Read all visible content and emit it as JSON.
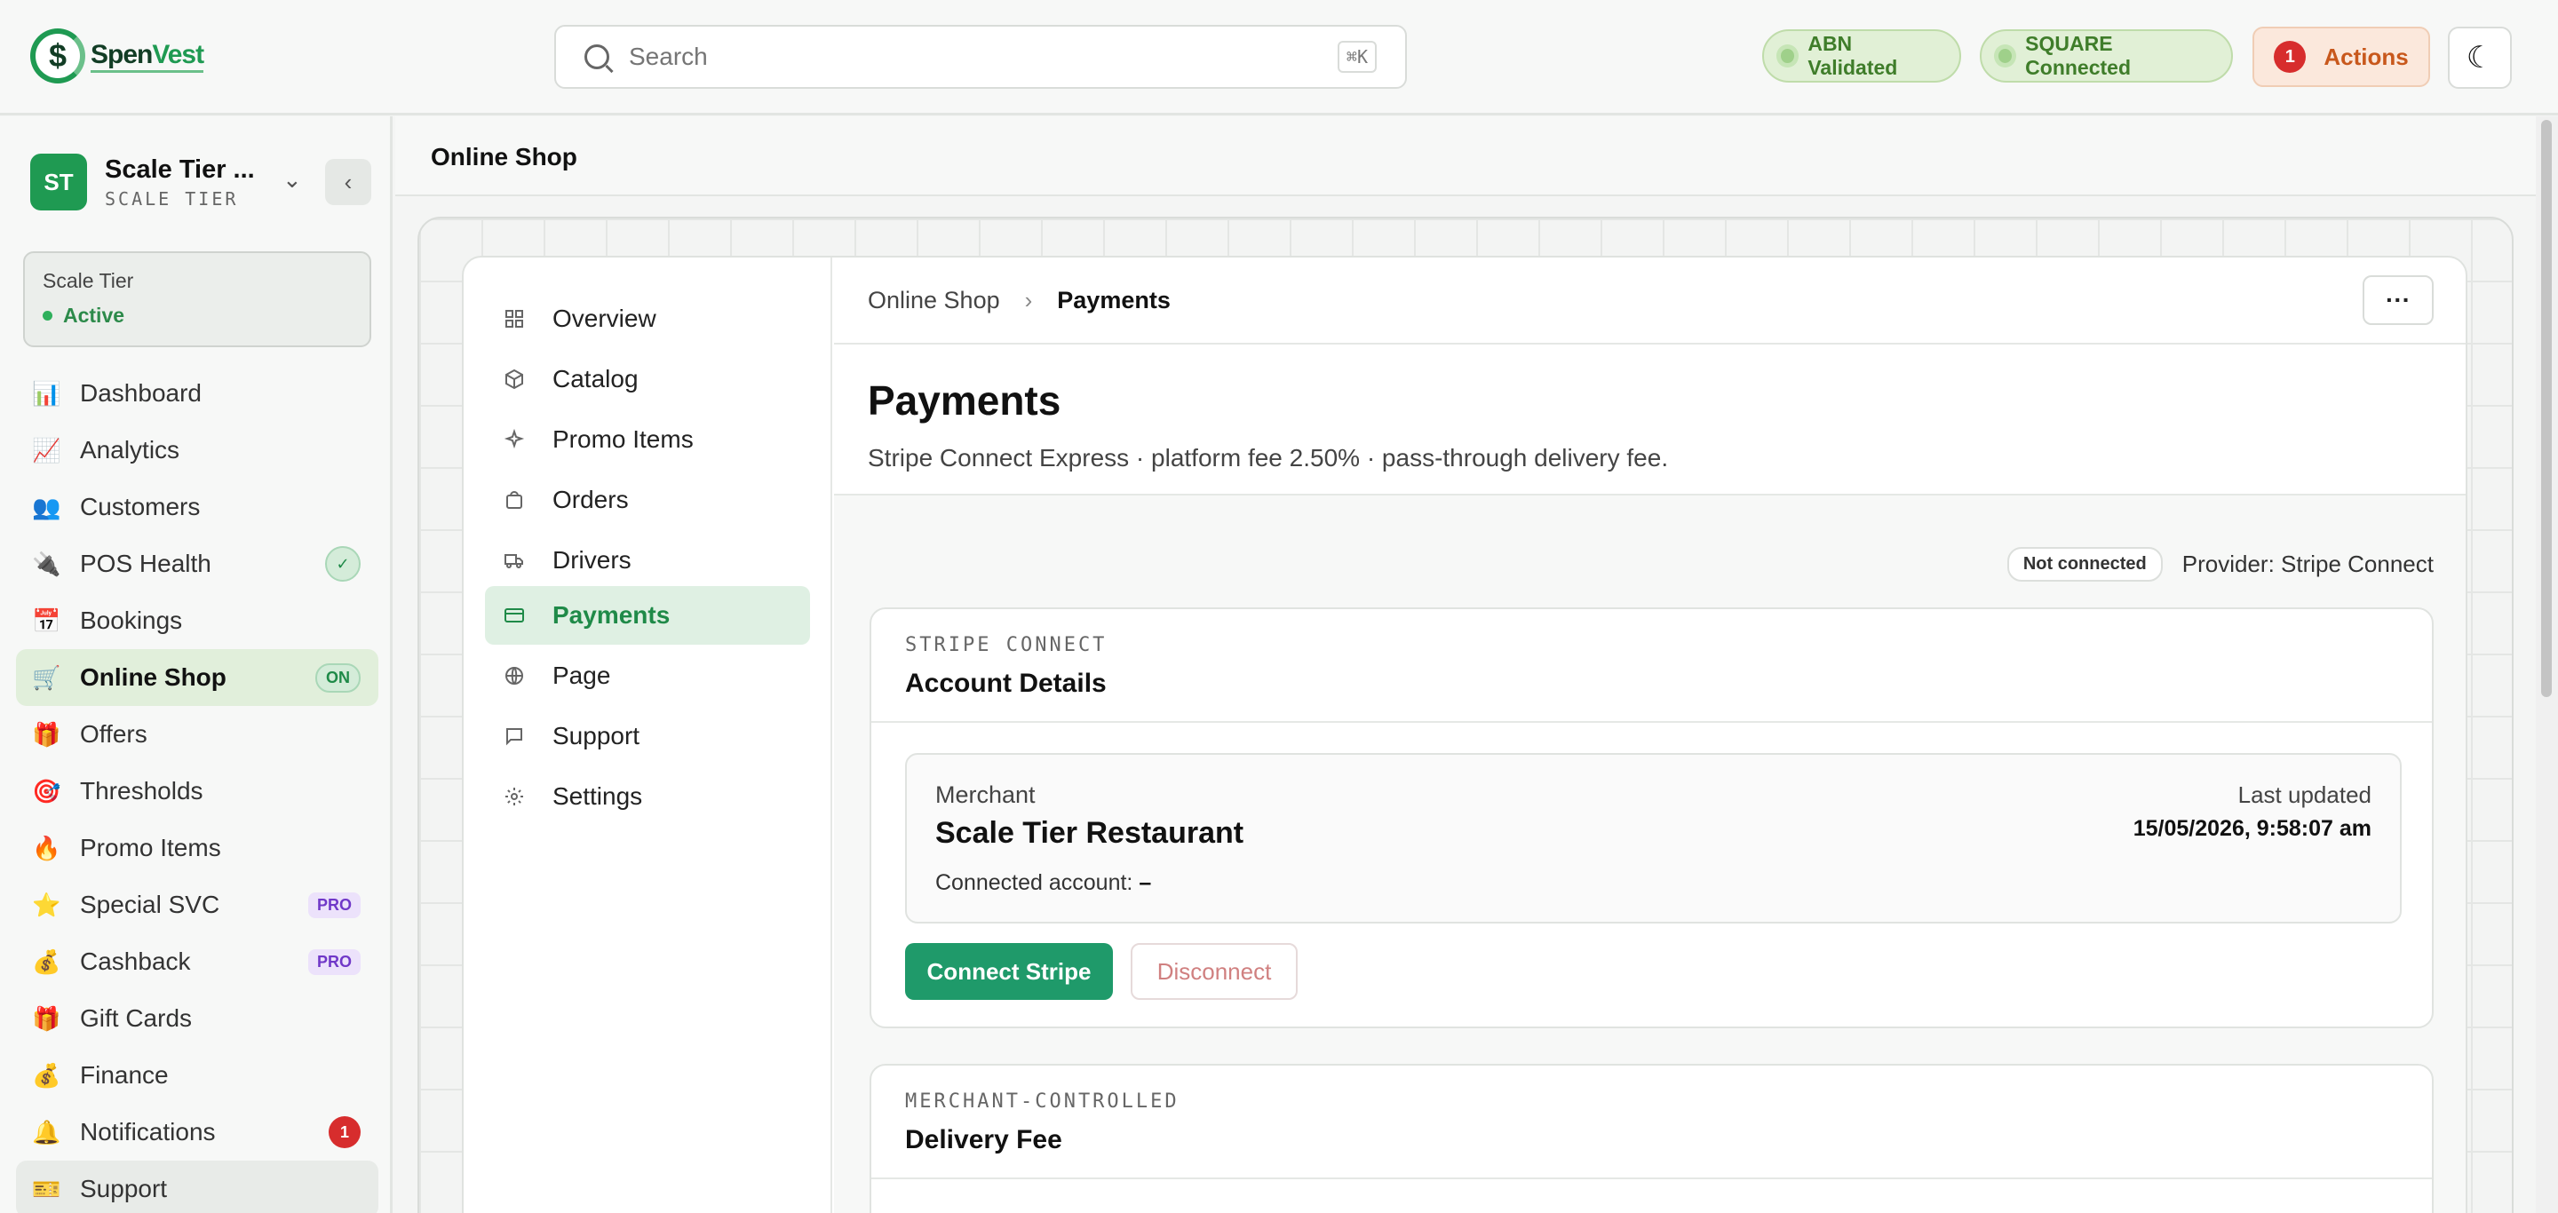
{
  "brand": {
    "name_part1": "Spen",
    "name_part2": "Vest",
    "logo_glyph": "$"
  },
  "topbar": {
    "search_placeholder": "Search",
    "search_shortcut": "⌘K",
    "pills": [
      {
        "label": "ABN Validated"
      },
      {
        "label": "SQUARE Connected"
      }
    ],
    "actions_label": "Actions",
    "actions_count": "1",
    "theme_icon": "☾"
  },
  "sidebar": {
    "org_initials": "ST",
    "org_name": "Scale Tier ...",
    "org_tier": "SCALE TIER",
    "tier_card": {
      "title": "Scale Tier",
      "status": "Active"
    },
    "items": [
      {
        "label": "Dashboard",
        "icon": "📊"
      },
      {
        "label": "Analytics",
        "icon": "📈"
      },
      {
        "label": "Customers",
        "icon": "👥"
      },
      {
        "label": "POS Health",
        "icon": "🔌",
        "badge": "✓"
      },
      {
        "label": "Bookings",
        "icon": "📅"
      },
      {
        "label": "Online Shop",
        "icon": "🛒",
        "badge": "ON"
      },
      {
        "label": "Offers",
        "icon": "🎁"
      },
      {
        "label": "Thresholds",
        "icon": "🎯"
      },
      {
        "label": "Promo Items",
        "icon": "🔥"
      },
      {
        "label": "Special SVC",
        "icon": "⭐",
        "badge": "PRO"
      },
      {
        "label": "Cashback",
        "icon": "💰",
        "badge": "PRO"
      },
      {
        "label": "Gift Cards",
        "icon": "🎁"
      },
      {
        "label": "Finance",
        "icon": "💰"
      },
      {
        "label": "Notifications",
        "icon": "🔔",
        "badge": "1"
      },
      {
        "label": "Support",
        "icon": "🎫"
      }
    ]
  },
  "main": {
    "title": "Online Shop",
    "subnav": [
      {
        "label": "Overview",
        "icon": "grid-icon"
      },
      {
        "label": "Catalog",
        "icon": "box-icon"
      },
      {
        "label": "Promo Items",
        "icon": "sparkle-icon"
      },
      {
        "label": "Orders",
        "icon": "bag-icon"
      },
      {
        "label": "Drivers",
        "icon": "truck-icon"
      },
      {
        "label": "Payments",
        "icon": "card-icon"
      },
      {
        "label": "Page",
        "icon": "globe-icon"
      },
      {
        "label": "Support",
        "icon": "chat-icon"
      },
      {
        "label": "Settings",
        "icon": "gear-icon"
      }
    ],
    "breadcrumb": {
      "parent": "Online Shop",
      "current": "Payments"
    },
    "more_label": "···",
    "page_title": "Payments",
    "page_subtitle": "Stripe Connect Express · platform fee 2.50% · pass-through delivery fee.",
    "status_chip": "Not connected",
    "provider_text": "Provider: Stripe Connect",
    "account_card": {
      "kicker": "STRIPE CONNECT",
      "title": "Account Details",
      "merchant_label": "Merchant",
      "merchant_name": "Scale Tier Restaurant",
      "connected_label": "Connected account:",
      "connected_value": "–",
      "updated_label": "Last updated",
      "updated_value": "15/05/2026, 9:58:07 am",
      "connect_label": "Connect Stripe",
      "disconnect_label": "Disconnect"
    },
    "delivery_card": {
      "kicker": "MERCHANT-CONTROLLED",
      "title": "Delivery Fee"
    }
  },
  "colors": {
    "brand_green": "#1f9a52",
    "primary_button": "#1f9a6a",
    "alert_red": "#d72d2d",
    "actions_orange": "#c8581c"
  }
}
